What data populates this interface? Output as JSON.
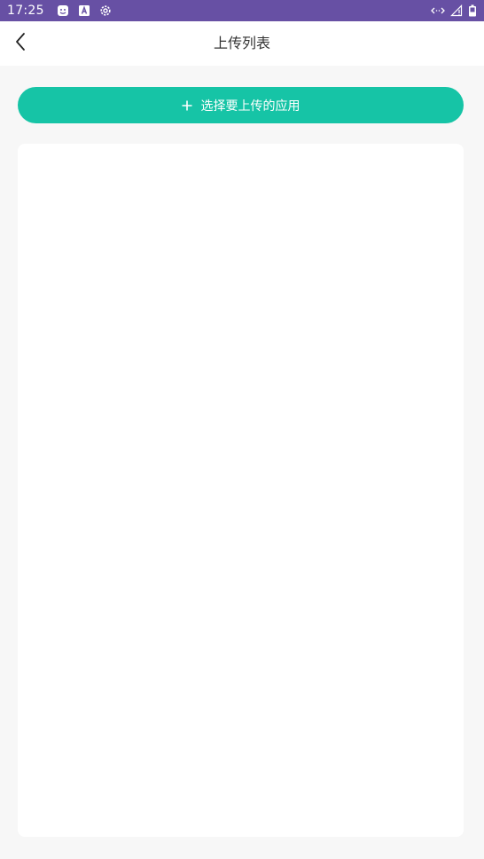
{
  "status_bar": {
    "time": "17:25",
    "left_icons": [
      "notification-face-icon",
      "text-a-icon",
      "settings-gear-icon"
    ],
    "right_icons": [
      "data-sync-icon",
      "cell-signal-icon",
      "battery-icon"
    ],
    "background_color": "#6750a4"
  },
  "app_bar": {
    "title": "上传列表",
    "back_icon": "chevron-left-icon"
  },
  "main": {
    "select_button_label": "选择要上传的应用",
    "select_button_icon": "plus-icon",
    "accent_color": "#16c4a6"
  }
}
